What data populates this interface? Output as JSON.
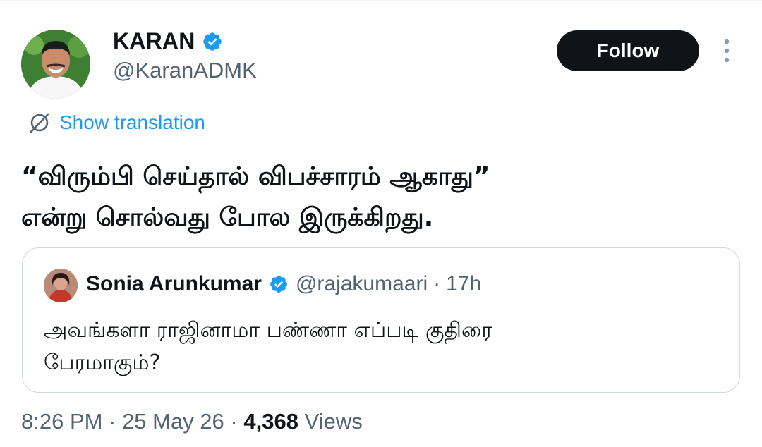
{
  "author": {
    "name": "KARAN",
    "handle": "@KaranADMK",
    "verified": true
  },
  "actions": {
    "follow_label": "Follow",
    "more_icon": "more-vertical-icon"
  },
  "translation": {
    "label": "Show translation",
    "icon": "translate-icon"
  },
  "tweet": {
    "line1": "“விரும்பி செய்தால் விபச்சாரம் ஆகாது”",
    "line2": "என்று சொல்வது போல இருக்கிறது."
  },
  "quoted_tweet": {
    "name": "Sonia Arunkumar",
    "handle": "@rajakumaari",
    "separator": "·",
    "time": "17h",
    "verified": true,
    "line1": "அவங்களா ராஜினாமா பண்ணா எப்படி குதிரை",
    "line2": "பேரமாகும்?"
  },
  "meta": {
    "time": "8:26 PM",
    "separator": "·",
    "date": "25 May 26",
    "views_count": "4,368",
    "views_label": "Views"
  },
  "colors": {
    "link": "#1d9bf0",
    "verified": "#1d9bf0",
    "secondary_text": "#536471",
    "primary_text": "#0f1419",
    "border": "#cfd9de"
  }
}
